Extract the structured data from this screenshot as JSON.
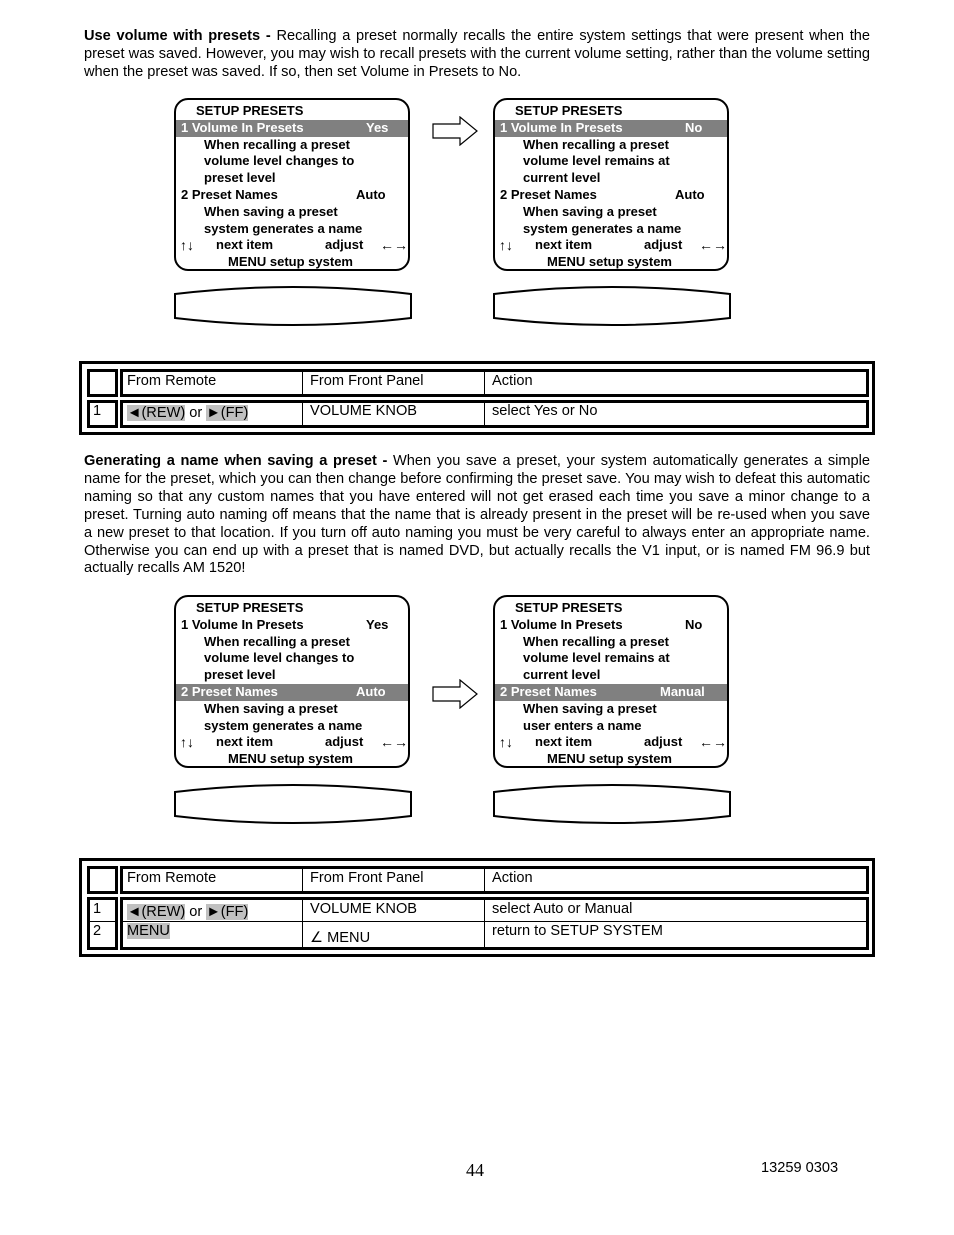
{
  "section1": {
    "heading": "Use volume with presets -",
    "body": " Recalling a  preset normally recalls the entire system settings that were present when the preset was saved. However, you may wish to recall presets with the current volume setting, rather than the volume setting when the preset was saved. If so, then set Volume in Presets to No."
  },
  "section2": {
    "heading": "Generating a name when saving a preset -",
    "body": " When you save a preset, your system  automatically generates a simple name for the preset, which you can then change before confirming the preset save. You may wish to defeat this automatic naming so that any custom names that you have entered will not get erased each time you save a minor change to a preset. Turning auto naming off means that the name that is already present in the preset will be re-used when you save a new preset to that location. If you turn off auto naming you must be very careful to  always enter an appropriate name. Otherwise you can end up with a preset that is named DVD, but actually recalls the V1 input, or is named FM 96.9 but actually recalls AM 1520!"
  },
  "osd_common": {
    "title": "SETUP PRESETS",
    "item1_label": "1  Volume In Presets",
    "item2_label": "2  Preset Names",
    "nav_next": "next item",
    "nav_adjust": "adjust",
    "nav_up_down": "↑↓",
    "nav_left_right": "←→",
    "menu_line": "MENU setup system"
  },
  "screens": [
    {
      "highlight": 1,
      "item1_value": "Yes",
      "item1_desc": [
        "When recalling a preset",
        "volume level changes to",
        "preset level"
      ],
      "item2_value": "Auto",
      "item2_desc": [
        "When saving a preset",
        "system generates a name"
      ]
    },
    {
      "highlight": 1,
      "item1_value": "No",
      "item1_desc": [
        "When recalling a preset",
        "volume level remains at",
        "current level"
      ],
      "item2_value": "Auto",
      "item2_desc": [
        "When saving a preset",
        "system generates a name"
      ]
    },
    {
      "highlight": 2,
      "item1_value": "Yes",
      "item1_desc": [
        "When recalling a preset",
        "volume level changes to",
        "preset level"
      ],
      "item2_value": "Auto",
      "item2_desc": [
        "When saving a preset",
        "system generates a name"
      ]
    },
    {
      "highlight": 2,
      "item1_value": "No",
      "item1_desc": [
        "When recalling a preset",
        "volume level remains at",
        "current level"
      ],
      "item2_value": "Manual",
      "item2_desc": [
        "When saving a preset",
        "user enters a name"
      ]
    }
  ],
  "table_headers": {
    "num": "",
    "remote": "From Remote",
    "panel": "From Front Panel",
    "action": "Action"
  },
  "table1": {
    "rows": [
      {
        "num": "1",
        "remote_rew": "◄(REW)",
        "remote_or": " or ",
        "remote_ff": "►(FF)",
        "panel": "VOLUME KNOB",
        "action": "select  Yes or No"
      }
    ]
  },
  "table2": {
    "rows": [
      {
        "num": "1",
        "remote_rew": "◄(REW)",
        "remote_or": " or ",
        "remote_ff": "►(FF)",
        "panel": "VOLUME KNOB",
        "action": "select  Auto or Manual"
      },
      {
        "num": "2",
        "remote": "MENU",
        "panel": "∠ MENU",
        "action": "return to SETUP SYSTEM"
      }
    ]
  },
  "footer": {
    "page_number": "44",
    "doc_code": "13259 0303"
  }
}
